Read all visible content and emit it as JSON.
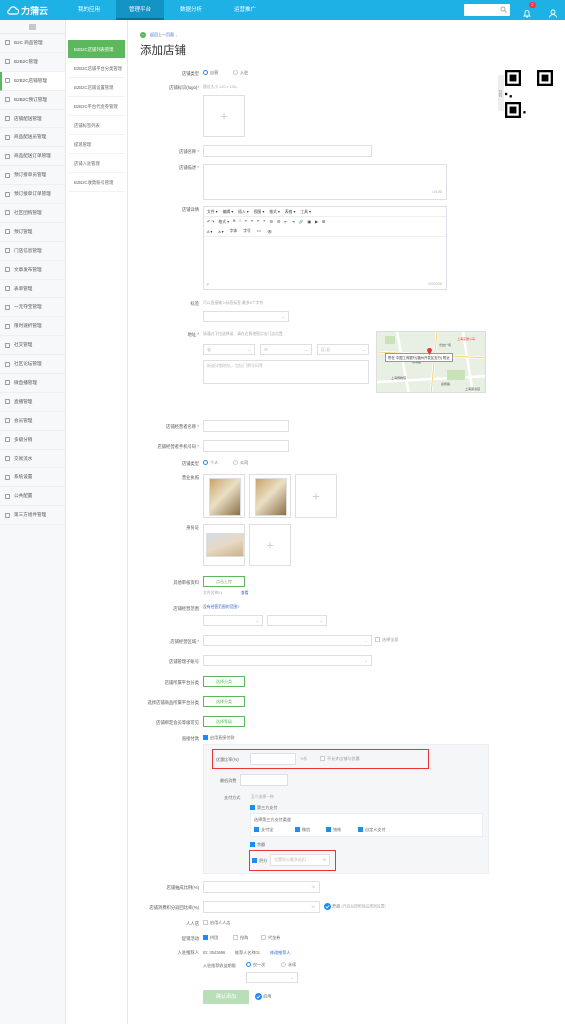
{
  "topbar": {
    "brand": "力蒲云",
    "nav": [
      "我的应用",
      "管理平台",
      "数据分析",
      "运营推广"
    ],
    "active_nav": 1,
    "bell_count": "2"
  },
  "sidebar1": [
    "B2C 商品管理",
    "B2B2C管理",
    "B2B2C店铺管理",
    "B2B2C预订管理",
    "店铺配送管理",
    "商品配送员管理",
    "商品配送订单管理",
    "预订接单员管理",
    "预订接单订单管理",
    "社区团购管理",
    "预订管理",
    "门店信息管理",
    "文章发布管理",
    "表单管理",
    "一元夺宝管理",
    "限时速折管理",
    "社交管理",
    "社区论坛管理",
    "微直播管理",
    "直播管理",
    "会员管理",
    "多级分销",
    "交易流水",
    "系统设置",
    "公共配置",
    "第三方组件管理"
  ],
  "sidebar1_active": 2,
  "sidebar2": [
    "B2B2C店铺列表管理",
    "B2B2C店铺平台分类管理",
    "B2B2C店铺设置管理",
    "B2B2C平台代金券管理",
    "店铺标签列表",
    "提现管理",
    "店铺入驻管理",
    "B2B2C收款账号管理"
  ],
  "sidebar2_active": 0,
  "breadcrumb": {
    "back": "返回上一页面"
  },
  "page_title": "添加店铺",
  "form": {
    "shop_type_label": "店铺类型",
    "shop_type_opts": [
      "自营",
      "入驻"
    ],
    "logo_label": "店铺标识(logo)",
    "logo_hint": "建议大小 120 x 120。",
    "name_label": "店铺名称",
    "desc_label": "店铺描述",
    "desc_count": "0/100",
    "detail_label": "店铺详情",
    "editor_row1": [
      "文件 ▾",
      "编辑 ▾",
      "插入 ▾",
      "视图 ▾",
      "格式 ▾",
      "表格 ▾",
      "工具 ▾"
    ],
    "editor_row2": [
      "↶ ↷",
      "格式 ▾",
      "B",
      "I",
      "≡",
      "≡",
      "≡",
      "≡",
      "☰",
      "☰",
      "⇤",
      "⇥",
      "🔗",
      "▣",
      "▶",
      "⊞"
    ],
    "editor_row3": [
      "A ▾",
      "A ▾",
      "字体",
      "字号",
      "<>",
      "👁"
    ],
    "editor_footer": "p",
    "editor_count": "0/20000",
    "tags_label": "标签",
    "tags_hint": "可以直接输入标签标签 最多8个字符",
    "addr_label": "地址",
    "addr_hint": "请通过下拉选择省、请在右侧地图点击门店位置",
    "addr_selects": [
      "省",
      "市",
      "区/县"
    ],
    "addr_detail_hint": "街道详细地址，包括门牌号码等",
    "map_label": "所在 中国工商银行(福州开发区支行) 附近",
    "map_places": [
      "上海东鼎小鸟",
      "南明路",
      "光启广场",
      "上海博物馆",
      "嘉杨路",
      "上海图书馆"
    ],
    "owner_label": "店铺经营者名称",
    "phone_label": "店铺经营者手机号码",
    "cert_type_label": "店铺类型",
    "cert_type_opts": [
      "个人",
      "公司"
    ],
    "license_label": "营业执照",
    "idcard_label": "身份证",
    "other_label": "其他审核资料",
    "other_btn": "点击上传",
    "other_file": "文件名称01",
    "other_view": "查看",
    "scope_label": "店铺经营范围",
    "scope_link": "没有经营范围的范围?",
    "area_label": "店铺经营区域",
    "area_opt": "选择全部",
    "child_label": "店铺管理子账号",
    "cat_label": "店铺所属平台分类",
    "cat_btn": "选择分类",
    "prod_cat_label": "选择店铺商品所属平台分类",
    "prod_cat_btn": "选择分类",
    "level_label": "店铺绑定会员等级可见",
    "level_btn": "选择等级",
    "direct_label": "直接付款",
    "direct_opt": "启用直接付款",
    "discount_label": "优惠比率(%)",
    "discount_unit": "%折",
    "discount_chk": "不允许店铺与优惠",
    "min_label": "最低消费",
    "pay_label": "支付方式",
    "pay_hint": "至少选择一种",
    "third_party": "第三方支付",
    "third_title": "选择第三方支付渠道",
    "third_opts": [
      "支付宝",
      "微信",
      "钱帐",
      "自定义支付"
    ],
    "balance": "余额",
    "points": "积分",
    "points_hint": "设置积分最多抵扣",
    "points_unit": "%",
    "commission_label": "店铺抽成比例(%)",
    "commission_unit": "%",
    "refund_label": "店铺消费积分返回比率(%)",
    "refund_unit": "%",
    "refund_toggle": "开启",
    "refund_hint": "(开启后按照商品规则设置)",
    "invite_label": "人人店",
    "invite_opt": "启用人人店",
    "activity_label": "促销活动",
    "activity_opts": [
      "拼团",
      "抢购",
      "代金券"
    ],
    "referrer_label": "入驻推荐人",
    "referrer_id": "ID: 3543696",
    "referrer_name": "推荐人名称01",
    "referrer_link": "修改推荐人",
    "earn_label": "入驻推荐收益期限",
    "earn_opts": [
      "仅一次",
      "永续"
    ],
    "submit": "确认添加",
    "agree": "启用"
  }
}
